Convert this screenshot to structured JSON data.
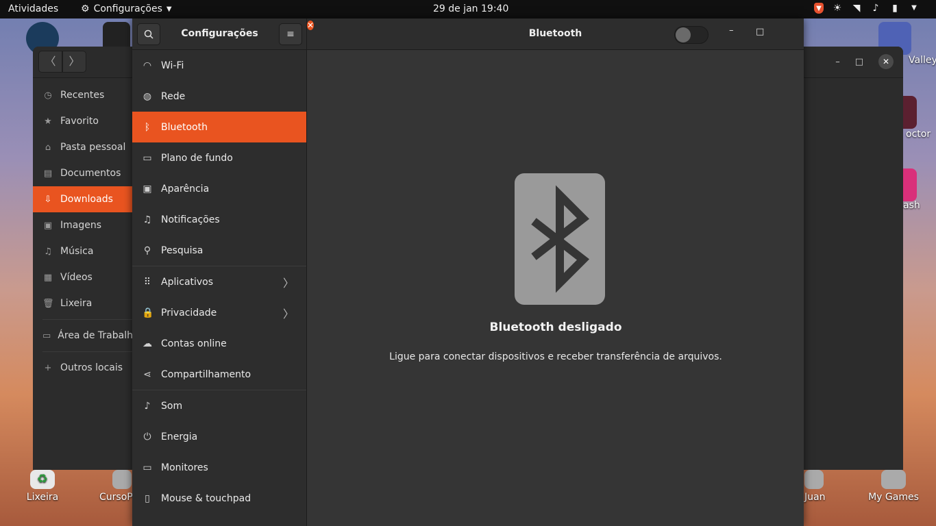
{
  "topbar": {
    "activities": "Atividades",
    "app_menu": "Configurações",
    "clock": "29 de jan  19:40",
    "tray_icons": [
      "brave-icon",
      "brightness-icon",
      "wifi-icon",
      "volume-icon",
      "battery-icon",
      "power-menu-icon"
    ]
  },
  "desktop": {
    "icons": [
      {
        "label": "Lixeira"
      },
      {
        "label": "CursoP"
      },
      {
        "label": "Juan"
      },
      {
        "label": "My Games"
      },
      {
        "label": "Valley"
      },
      {
        "label": "octor"
      },
      {
        "label": "ash"
      }
    ]
  },
  "files_window": {
    "sidebar": [
      {
        "label": "Recentes",
        "icon": "clock-icon"
      },
      {
        "label": "Favorito",
        "icon": "star-icon"
      },
      {
        "label": "Pasta pessoal",
        "icon": "home-icon"
      },
      {
        "label": "Documentos",
        "icon": "document-icon"
      },
      {
        "label": "Downloads",
        "icon": "download-icon",
        "active": true
      },
      {
        "label": "Imagens",
        "icon": "image-icon"
      },
      {
        "label": "Música",
        "icon": "music-icon"
      },
      {
        "label": "Vídeos",
        "icon": "video-icon"
      },
      {
        "label": "Lixeira",
        "icon": "trash-icon"
      },
      {
        "label": "Área de Trabalho",
        "icon": "desktop-icon"
      },
      {
        "label": "Outros locais",
        "icon": "plus-icon"
      }
    ]
  },
  "settings": {
    "title": "Configurações",
    "panel_title": "Bluetooth",
    "bluetooth_enabled": false,
    "nav": [
      {
        "label": "Wi-Fi",
        "icon": "wifi-icon"
      },
      {
        "label": "Rede",
        "icon": "globe-icon"
      },
      {
        "label": "Bluetooth",
        "icon": "bluetooth-icon",
        "active": true
      },
      {
        "label": "Plano de fundo",
        "icon": "wallpaper-icon"
      },
      {
        "label": "Aparência",
        "icon": "appearance-icon"
      },
      {
        "label": "Notificações",
        "icon": "bell-icon"
      },
      {
        "label": "Pesquisa",
        "icon": "search-icon"
      },
      {
        "label": "Aplicativos",
        "icon": "apps-grid-icon",
        "chevron": true
      },
      {
        "label": "Privacidade",
        "icon": "lock-icon",
        "chevron": true
      },
      {
        "label": "Contas online",
        "icon": "cloud-icon"
      },
      {
        "label": "Compartilhamento",
        "icon": "share-icon"
      },
      {
        "label": "Som",
        "icon": "music-note-icon"
      },
      {
        "label": "Energia",
        "icon": "power-icon"
      },
      {
        "label": "Monitores",
        "icon": "monitor-icon"
      },
      {
        "label": "Mouse & touchpad",
        "icon": "mouse-icon"
      }
    ],
    "empty_state": {
      "title": "Bluetooth desligado",
      "description": "Ligue para conectar dispositivos e receber transferência de arquivos."
    }
  },
  "colors": {
    "accent": "#e95420",
    "panel_bg": "#353535",
    "sidebar_bg": "#2d2d2d",
    "topbar_bg": "#101010"
  }
}
